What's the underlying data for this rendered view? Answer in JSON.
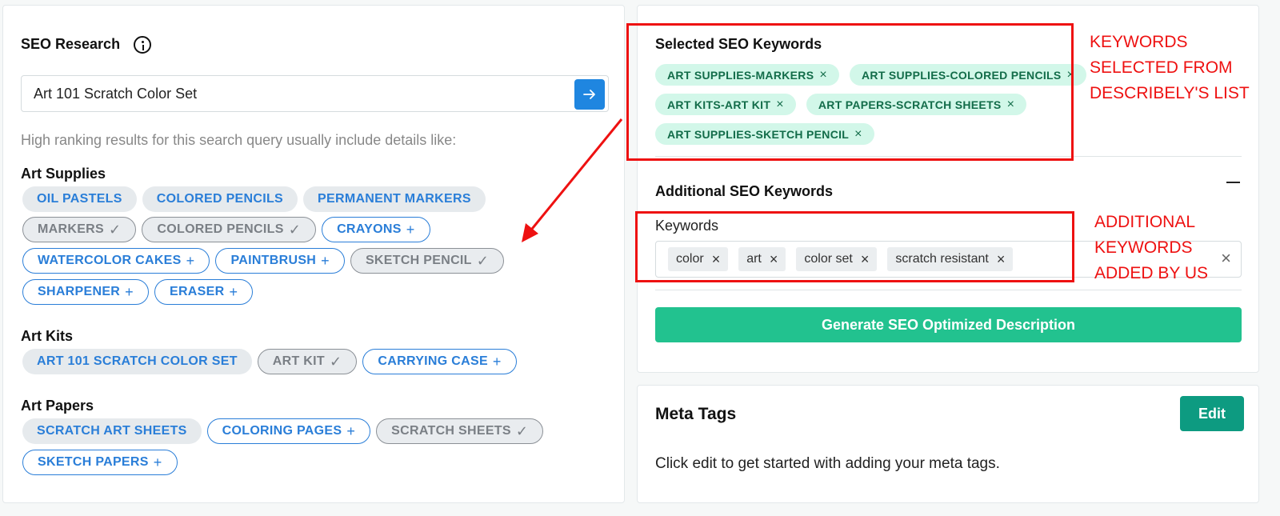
{
  "colors": {
    "accent_blue": "#2a7ed8",
    "kw_chip_bg": "#d2f7e9",
    "kw_chip_text": "#126c49",
    "generate_button": "#22c28f",
    "edit_button": "#0d9b81",
    "annotation_red": "#ee1111"
  },
  "seo_research": {
    "title": "SEO Research",
    "info_icon": "info-circle-icon",
    "search_value": "Art 101 Scratch Color Set",
    "go_icon": "arrow-right-icon",
    "hint": "High ranking results for this search query usually include details like:",
    "groups": [
      {
        "title": "Art Supplies",
        "rows": [
          [
            {
              "label": "OIL PASTELS",
              "mark": ""
            },
            {
              "label": "COLORED PENCILS",
              "mark": ""
            },
            {
              "label": "PERMANENT MARKERS",
              "mark": ""
            }
          ],
          [
            {
              "label": "MARKERS",
              "mark": "✓"
            },
            {
              "label": "COLORED PENCILS",
              "mark": "✓"
            },
            {
              "label": "CRAYONS",
              "mark": "+"
            }
          ],
          [
            {
              "label": "WATERCOLOR CAKES",
              "mark": "+"
            },
            {
              "label": "PAINTBRUSH",
              "mark": "+"
            },
            {
              "label": "SKETCH PENCIL",
              "mark": "✓"
            }
          ],
          [
            {
              "label": "SHARPENER",
              "mark": "+"
            },
            {
              "label": "ERASER",
              "mark": "+"
            }
          ]
        ]
      },
      {
        "title": "Art Kits",
        "rows": [
          [
            {
              "label": "ART 101 SCRATCH COLOR SET",
              "mark": ""
            },
            {
              "label": "ART KIT",
              "mark": "✓"
            },
            {
              "label": "CARRYING CASE",
              "mark": "+"
            }
          ]
        ]
      },
      {
        "title": "Art Papers",
        "rows": [
          [
            {
              "label": "SCRATCH ART SHEETS",
              "mark": ""
            },
            {
              "label": "COLORING PAGES",
              "mark": "+"
            },
            {
              "label": "SCRATCH SHEETS",
              "mark": "✓"
            }
          ],
          [
            {
              "label": "SKETCH PAPERS",
              "mark": "+"
            }
          ]
        ]
      }
    ]
  },
  "selected_keywords": {
    "title": "Selected SEO Keywords",
    "remove_symbol": "×",
    "rows": [
      [
        "ART SUPPLIES-MARKERS",
        "ART SUPPLIES-COLORED PENCILS"
      ],
      [
        "ART KITS-ART KIT",
        "ART PAPERS-SCRATCH SHEETS"
      ],
      [
        "ART SUPPLIES-SKETCH PENCIL"
      ]
    ]
  },
  "additional_keywords": {
    "title": "Additional SEO Keywords",
    "collapse_icon": "minus-icon",
    "field_label": "Keywords",
    "tags": [
      "color",
      "art",
      "color set",
      "scratch resistant"
    ],
    "remove_symbol": "×",
    "clear_symbol": "×"
  },
  "generate_button_label": "Generate SEO Optimized Description",
  "meta_tags": {
    "title": "Meta Tags",
    "edit_label": "Edit",
    "description": "Click edit to get started with adding your meta tags."
  },
  "annotations": {
    "selected_note": "KEYWORDS\nSELECTED FROM\nDESCRIBELY'S LIST",
    "additional_note": "ADDITIONAL\nKEYWORDS\nADDED BY US"
  }
}
